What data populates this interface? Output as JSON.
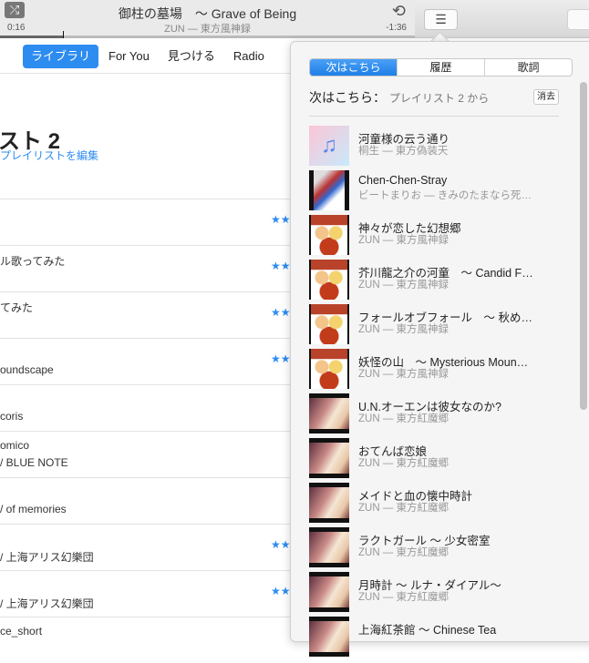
{
  "player": {
    "title": "御柱の墓場　～ Grave of Being",
    "artist": "ZUN — 東方風神録",
    "elapsed": "0:16",
    "remaining": "-1:36",
    "progress_fraction": 0.15
  },
  "nav": {
    "tabs": [
      "ライブラリ",
      "For You",
      "見つける",
      "Radio"
    ],
    "active": 0
  },
  "playlist": {
    "title": "スト 2",
    "edit": "プレイリストを編集",
    "rows": [
      {
        "l1": "",
        "l2": "",
        "stars": "★★"
      },
      {
        "l1": "ル歌ってみた",
        "l2": "",
        "stars": "★★"
      },
      {
        "l1": "てみた",
        "l2": "",
        "stars": "★★"
      },
      {
        "l1": "",
        "l2": "oundscape",
        "stars": "★★"
      },
      {
        "l1": "",
        "l2": "coris",
        "stars": ""
      },
      {
        "l1": "omico",
        "l2": "/ BLUE NOTE",
        "stars": ""
      },
      {
        "l1": "",
        "l2": "/ of memories",
        "stars": ""
      },
      {
        "l1": "",
        "l2": "/ 上海アリス幻樂団",
        "stars": "★★"
      },
      {
        "l1": "",
        "l2": "/ 上海アリス幻樂団",
        "stars": "★★"
      },
      {
        "l1": "ce_short",
        "l2": "",
        "stars": ""
      }
    ]
  },
  "upnext": {
    "tabs": [
      "次はこちら",
      "履歴",
      "歌詞"
    ],
    "heading": "次はこちら：",
    "source": "プレイリスト 2 から",
    "clear": "消去",
    "items": [
      {
        "title": "河童様の云う通り",
        "sub": "桐生 — 東方偽装天",
        "art": "music"
      },
      {
        "title": "Chen-Chen-Stray",
        "sub": "ビートまりお — きみのたまなら死…",
        "art": "chen"
      },
      {
        "title": "神々が恋した幻想郷",
        "sub": "ZUN — 東方風神録",
        "art": "fuu"
      },
      {
        "title": "芥川龍之介の河童　～ Candid F…",
        "sub": "ZUN — 東方風神録",
        "art": "fuu"
      },
      {
        "title": "フォールオブフォール　～ 秋め…",
        "sub": "ZUN — 東方風神録",
        "art": "fuu"
      },
      {
        "title": "妖怪の山　～ Mysterious Moun…",
        "sub": "ZUN — 東方風神録",
        "art": "fuu"
      },
      {
        "title": "U.N.オーエンは彼女なのか?",
        "sub": "ZUN — 東方紅魔郷",
        "art": "kou"
      },
      {
        "title": "おてんば恋娘",
        "sub": "ZUN — 東方紅魔郷",
        "art": "kou"
      },
      {
        "title": "メイドと血の懐中時計",
        "sub": "ZUN — 東方紅魔郷",
        "art": "kou"
      },
      {
        "title": "ラクトガール ～ 少女密室",
        "sub": "ZUN — 東方紅魔郷",
        "art": "kou"
      },
      {
        "title": "月時計 ～ ルナ・ダイアル～",
        "sub": "ZUN — 東方紅魔郷",
        "art": "kou"
      },
      {
        "title": "上海紅茶館 ～ Chinese Tea",
        "sub": "",
        "art": "kou"
      }
    ]
  }
}
